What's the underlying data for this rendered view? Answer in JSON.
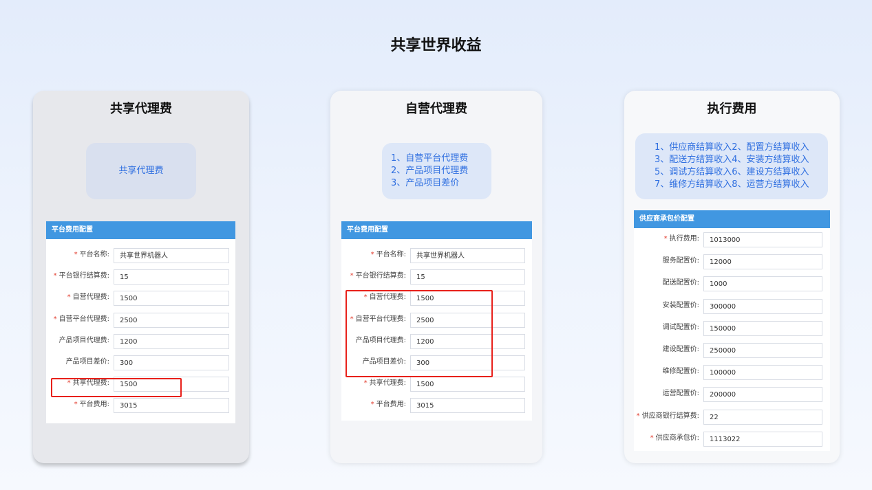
{
  "page": {
    "title": "共享世界收益"
  },
  "colors": {
    "accent": "#4197e1",
    "link": "#2f6fe0",
    "required": "#e23a2c",
    "highlight": "#e8201a"
  },
  "cards": [
    {
      "title": "共享代理费",
      "summary": [
        "共享代理费"
      ],
      "panel": {
        "header": "平台费用配置",
        "rows": [
          {
            "label": "平台名称:",
            "required": true,
            "value": "共享世界机器人"
          },
          {
            "label": "平台银行结算费:",
            "required": true,
            "value": "15"
          },
          {
            "label": "自营代理费:",
            "required": true,
            "value": "1500"
          },
          {
            "label": "自营平台代理费:",
            "required": true,
            "value": "2500"
          },
          {
            "label": "产品项目代理费:",
            "required": false,
            "value": "1200"
          },
          {
            "label": "产品项目差价:",
            "required": false,
            "value": "300"
          },
          {
            "label": "共享代理费:",
            "required": true,
            "value": "1500"
          },
          {
            "label": "平台费用:",
            "required": true,
            "value": "3015"
          }
        ]
      }
    },
    {
      "title": "自营代理费",
      "summary": [
        "1、自营平台代理费",
        "2、产品项目代理费",
        "3、产品项目差价"
      ],
      "panel": {
        "header": "平台费用配置",
        "rows": [
          {
            "label": "平台名称:",
            "required": true,
            "value": "共享世界机器人"
          },
          {
            "label": "平台银行结算费:",
            "required": true,
            "value": "15"
          },
          {
            "label": "自营代理费:",
            "required": true,
            "value": "1500"
          },
          {
            "label": "自营平台代理费:",
            "required": true,
            "value": "2500"
          },
          {
            "label": "产品项目代理费:",
            "required": false,
            "value": "1200"
          },
          {
            "label": "产品项目差价:",
            "required": false,
            "value": "300"
          },
          {
            "label": "共享代理费:",
            "required": true,
            "value": "1500"
          },
          {
            "label": "平台费用:",
            "required": true,
            "value": "3015"
          }
        ]
      }
    },
    {
      "title": "执行费用",
      "summary": [
        "1、供应商结算收入2、配置方结算收入",
        "3、配送方结算收入4、安装方结算收入",
        "5、调试方结算收入6、建设方结算收入",
        "7、维修方结算收入8、运营方结算收入"
      ],
      "panel": {
        "header": "供应商承包价配置",
        "rows": [
          {
            "label": "执行费用:",
            "required": true,
            "value": "1013000"
          },
          {
            "label": "服务配置价:",
            "required": false,
            "value": "12000"
          },
          {
            "label": "配送配置价:",
            "required": false,
            "value": "1000"
          },
          {
            "label": "安装配置价:",
            "required": false,
            "value": "300000"
          },
          {
            "label": "调试配置价:",
            "required": false,
            "value": "150000"
          },
          {
            "label": "建设配置价:",
            "required": false,
            "value": "250000"
          },
          {
            "label": "维修配置价:",
            "required": false,
            "value": "100000"
          },
          {
            "label": "运营配置价:",
            "required": false,
            "value": "200000"
          },
          {
            "label": "供应商银行结算费:",
            "required": true,
            "value": "22"
          },
          {
            "label": "供应商承包价:",
            "required": true,
            "value": "1113022"
          }
        ]
      }
    }
  ]
}
